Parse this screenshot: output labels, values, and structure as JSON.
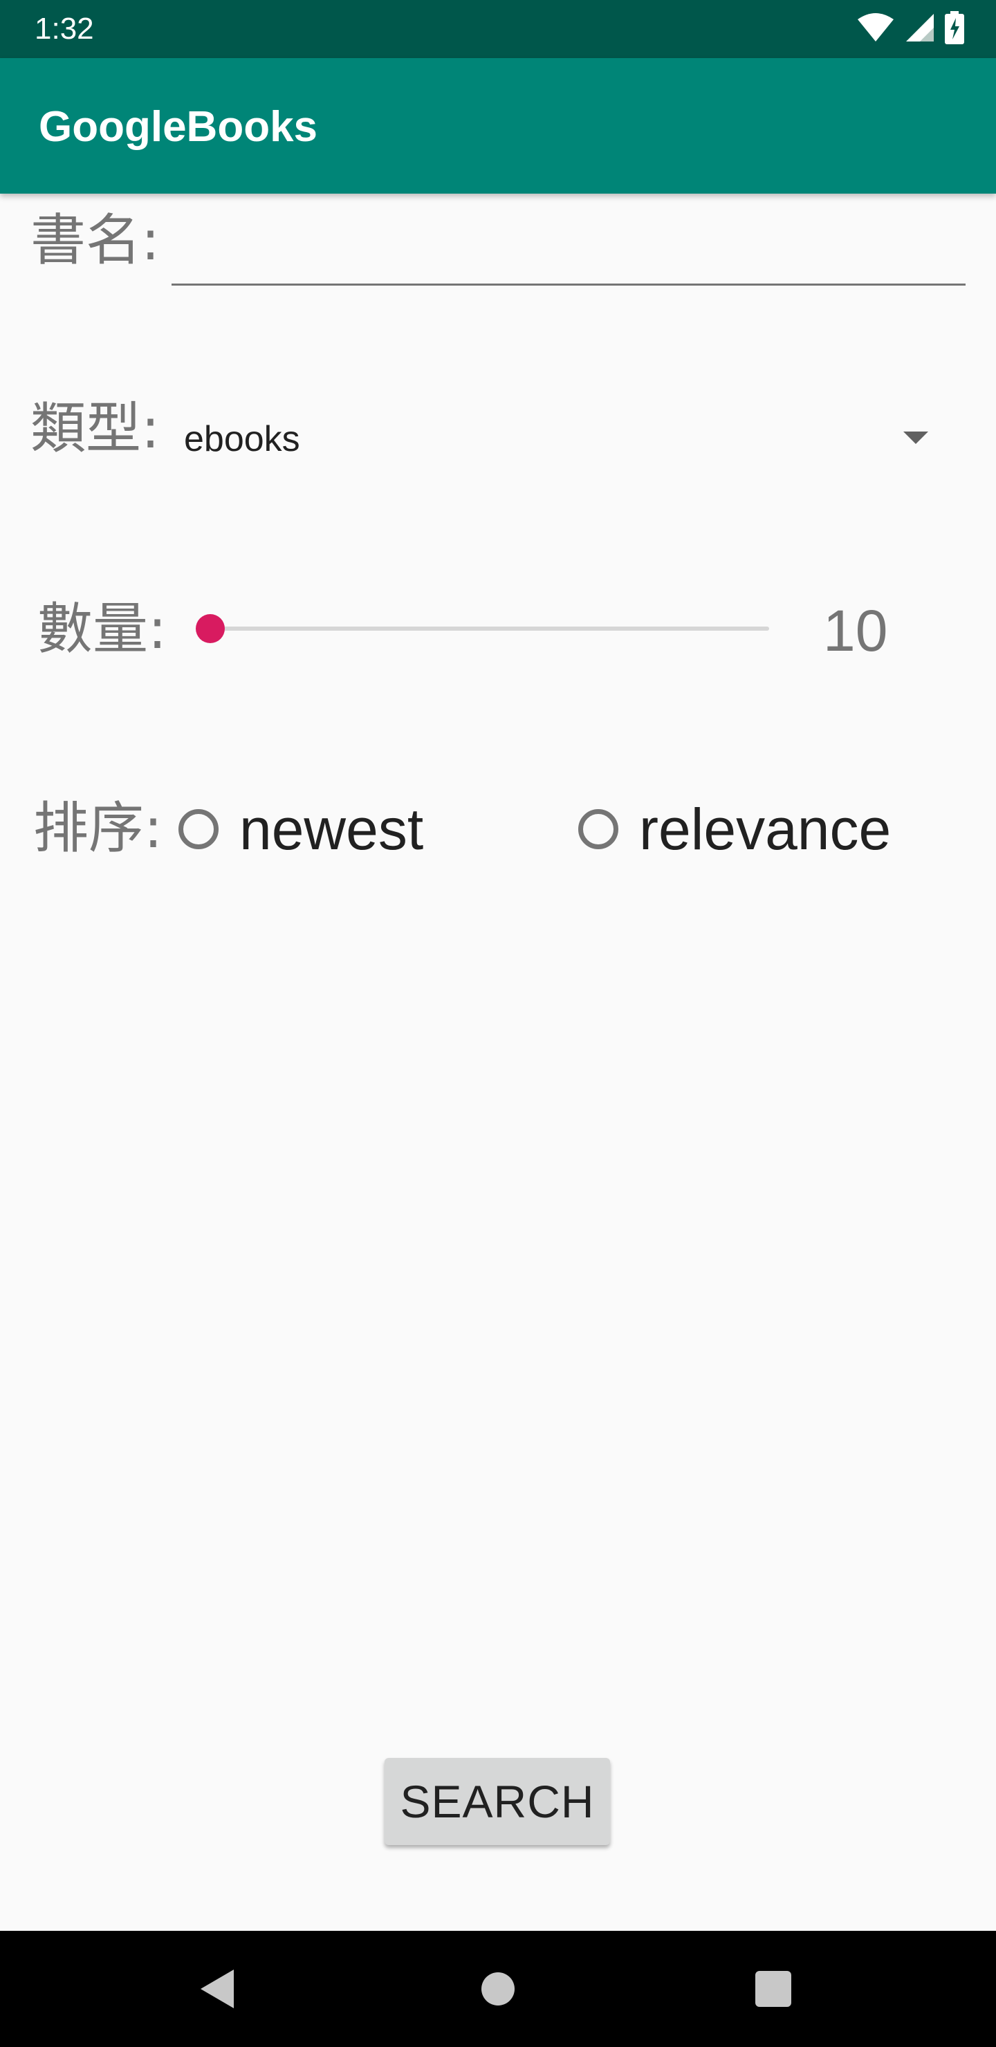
{
  "status_bar": {
    "time": "1:32",
    "icons": [
      "wifi-icon",
      "signal-icon",
      "battery-charging-icon"
    ]
  },
  "app_bar": {
    "title": "GoogleBooks"
  },
  "form": {
    "title_label": "書名:",
    "title_value": "",
    "type_label": "類型:",
    "type_selected": "ebooks",
    "count_label": "數量:",
    "count_value": "10",
    "count_slider_fraction": 0.0,
    "sort_label": "排序:",
    "sort_options": [
      {
        "label": "newest",
        "checked": false
      },
      {
        "label": "relevance",
        "checked": false
      }
    ]
  },
  "search_button": {
    "label": "SEARCH"
  },
  "nav_bar": {
    "buttons": [
      "back-icon",
      "home-icon",
      "recents-icon"
    ]
  },
  "colors": {
    "status_bar": "#00574b",
    "app_bar": "#008577",
    "accent": "#d81b60",
    "background": "#fafafa"
  }
}
